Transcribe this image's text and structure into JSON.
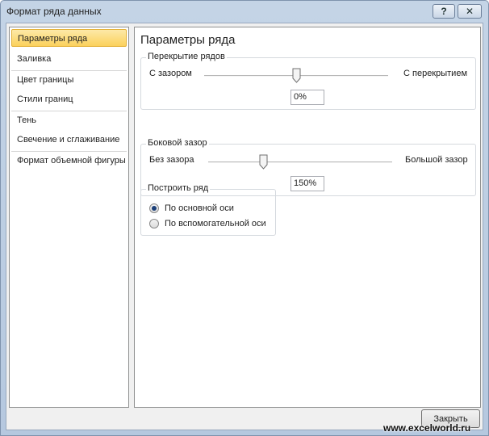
{
  "window": {
    "title": "Формат ряда данных",
    "help_glyph": "?",
    "close_glyph": "✕"
  },
  "nav": {
    "items": [
      {
        "label": "Параметры ряда",
        "selected": true
      },
      {
        "label": "Заливка"
      },
      {
        "label": "Цвет границы"
      },
      {
        "label": "Стили границ"
      },
      {
        "label": "Тень"
      },
      {
        "label": "Свечение и сглаживание"
      },
      {
        "label": "Формат объемной фигуры"
      }
    ]
  },
  "content": {
    "title": "Параметры ряда",
    "overlap": {
      "group_label": "Перекрытие рядов",
      "min_label": "С зазором",
      "max_label": "С перекрытием",
      "value": "0%",
      "slider_fraction": 0.5
    },
    "gap": {
      "group_label": "Боковой зазор",
      "min_label": "Без зазора",
      "max_label": "Большой зазор",
      "value": "150%",
      "slider_fraction": 0.3
    },
    "plot_on": {
      "group_label": "Построить ряд",
      "options": [
        {
          "label": "По основной оси",
          "checked": true
        },
        {
          "label": "По вспомогательной оси",
          "checked": false
        }
      ]
    }
  },
  "footer": {
    "close_label": "Закрыть"
  },
  "watermark": "www.excelworld.ru",
  "colors": {
    "selected_nav_bg": "#fbd15c",
    "titlebar_bg": "#c4d4e6"
  }
}
